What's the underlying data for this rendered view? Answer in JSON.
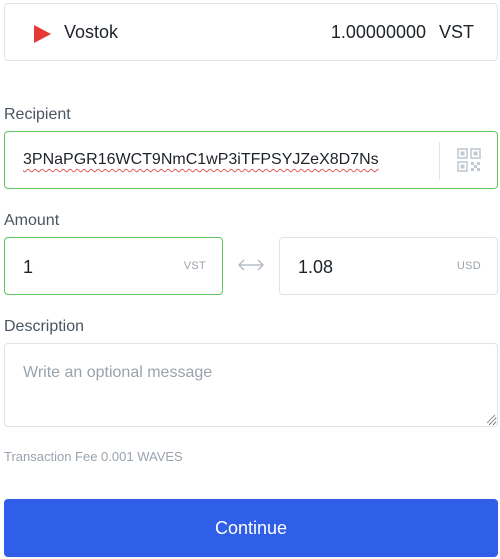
{
  "asset": {
    "name": "Vostok",
    "balance": "1.00000000",
    "ticker": "VST",
    "icon": "play-triangle-icon",
    "icon_color": "#e53935"
  },
  "recipient": {
    "label": "Recipient",
    "value": "3PNaPGR16WCT9NmC1wP3iTFPSYJZeX8D7Ns",
    "qr_icon": "qr-code-icon"
  },
  "amount": {
    "label": "Amount",
    "value": "1",
    "unit": "VST",
    "converted_value": "1.08",
    "converted_unit": "USD",
    "swap_icon": "swap-arrows-icon"
  },
  "description": {
    "label": "Description",
    "placeholder": "Write an optional message"
  },
  "fee": {
    "text": "Transaction Fee 0.001 WAVES"
  },
  "actions": {
    "continue_label": "Continue",
    "primary_color": "#2f5ee8"
  },
  "colors": {
    "valid_border": "#5fc35f",
    "default_border": "#dfe3ea",
    "muted_text": "#9aa3ad"
  }
}
